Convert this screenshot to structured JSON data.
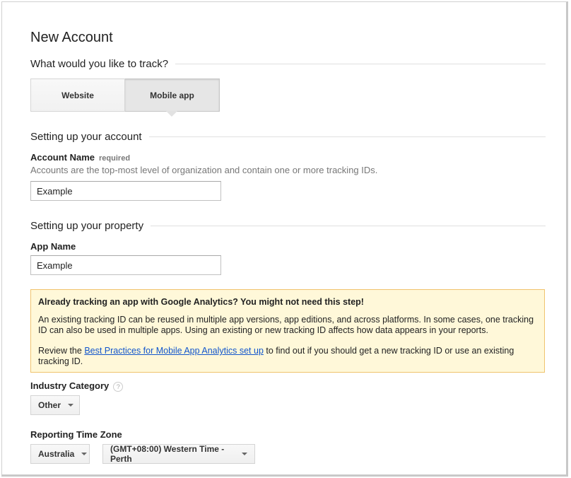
{
  "page": {
    "title": "New Account"
  },
  "track": {
    "question": "What would you like to track?",
    "options": [
      "Website",
      "Mobile app"
    ],
    "selected": "Mobile app"
  },
  "account_section": {
    "heading": "Setting up your account",
    "name_label": "Account Name",
    "required_tag": "required",
    "help": "Accounts are the top-most level of organization and contain one or more tracking IDs.",
    "name_value": "Example"
  },
  "property_section": {
    "heading": "Setting up your property",
    "app_name_label": "App Name",
    "app_name_value": "Example"
  },
  "notice": {
    "title": "Already tracking an app with Google Analytics? You might not need this step!",
    "body": "An existing tracking ID can be reused in multiple app versions, app editions, and across platforms. In some cases, one tracking ID can also be used in multiple apps. Using an existing or new tracking ID affects how data appears in your reports.",
    "review_prefix": "Review the ",
    "link_text": "Best Practices for Mobile App Analytics set up",
    "review_suffix": " to find out if you should get a new tracking ID or use an existing tracking ID."
  },
  "industry": {
    "label": "Industry Category",
    "help_glyph": "?",
    "value": "Other"
  },
  "timezone": {
    "label": "Reporting Time Zone",
    "country": "Australia",
    "zone": "(GMT+08:00) Western Time - Perth"
  }
}
